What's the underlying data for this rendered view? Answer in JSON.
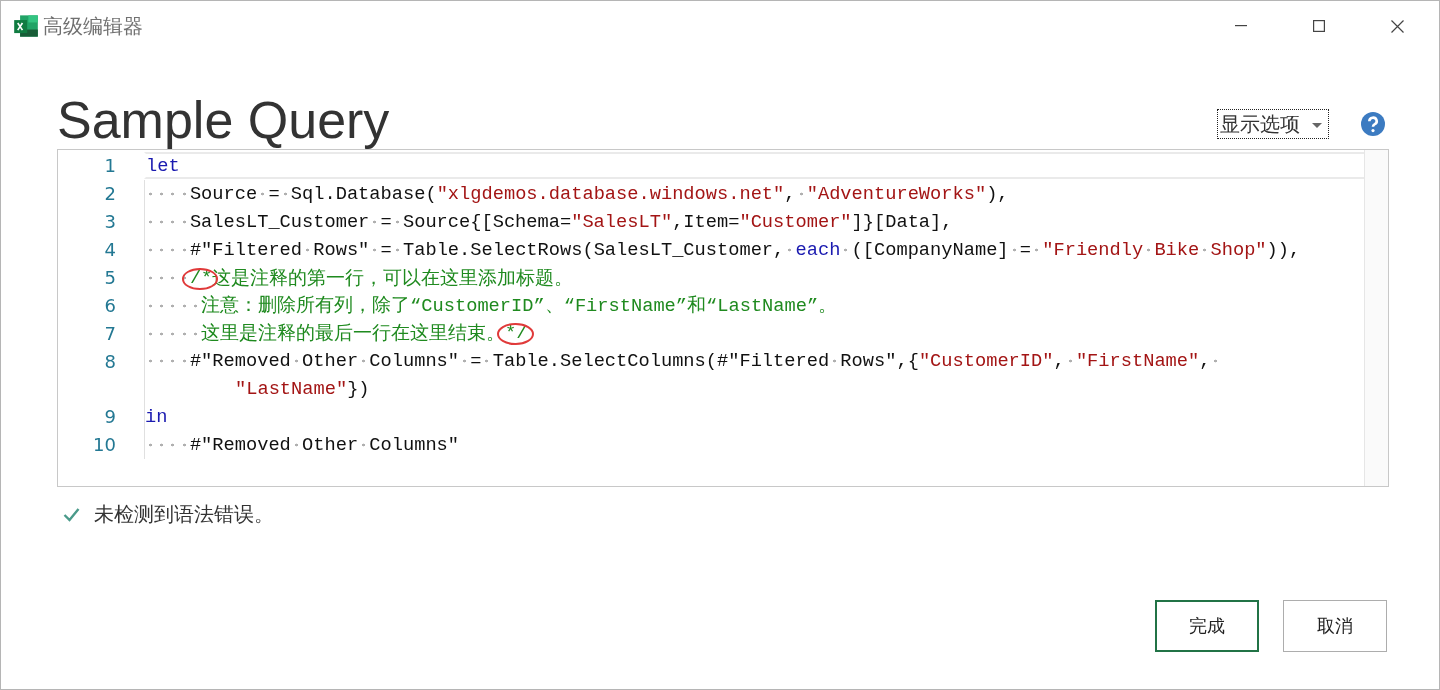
{
  "window": {
    "title": "高级编辑器"
  },
  "heading": "Sample Query",
  "options_dropdown": {
    "label": "显示选项"
  },
  "editor": {
    "lines": [
      {
        "number": "1",
        "current": true,
        "tokens": [
          {
            "kind": "keyword",
            "text": "let"
          }
        ]
      },
      {
        "number": "2",
        "current": false,
        "tokens": [
          {
            "kind": "plain",
            "text": "    Source = Sql.Database("
          },
          {
            "kind": "string",
            "text": "\"xlgdemos.database.windows.net\""
          },
          {
            "kind": "plain",
            "text": ", "
          },
          {
            "kind": "string",
            "text": "\"AdventureWorks\""
          },
          {
            "kind": "plain",
            "text": "),"
          }
        ]
      },
      {
        "number": "3",
        "current": false,
        "tokens": [
          {
            "kind": "plain",
            "text": "    SalesLT_Customer = Source{[Schema="
          },
          {
            "kind": "string",
            "text": "\"SalesLT\""
          },
          {
            "kind": "plain",
            "text": ",Item="
          },
          {
            "kind": "string",
            "text": "\"Customer\""
          },
          {
            "kind": "plain",
            "text": "]}[Data],"
          }
        ]
      },
      {
        "number": "4",
        "current": false,
        "tokens": [
          {
            "kind": "plain",
            "text": "    #\"Filtered Rows\" = Table.SelectRows(SalesLT_Customer, "
          },
          {
            "kind": "keyword",
            "text": "each"
          },
          {
            "kind": "plain",
            "text": " ([CompanyName] = "
          },
          {
            "kind": "string",
            "text": "\"Friendly Bike Shop\""
          },
          {
            "kind": "plain",
            "text": ")),"
          }
        ]
      },
      {
        "number": "5",
        "current": false,
        "tokens": [
          {
            "kind": "comment",
            "text": "    /*",
            "circled": true
          },
          {
            "kind": "comment",
            "text": "这是注释的第一行，可以在这里添加标题。"
          }
        ]
      },
      {
        "number": "6",
        "current": false,
        "tokens": [
          {
            "kind": "comment",
            "text": "     注意：删除所有列，除了“CustomerID”、“FirstName”和“LastName”。"
          }
        ]
      },
      {
        "number": "7",
        "current": false,
        "tokens": [
          {
            "kind": "comment",
            "text": "     这里是注释的最后一行在这里结束。"
          },
          {
            "kind": "comment",
            "text": "*/",
            "circled": true
          }
        ]
      },
      {
        "number": "8",
        "current": false,
        "tokens": [
          {
            "kind": "plain",
            "text": "    #\"Removed Other Columns\" = Table.SelectColumns(#\"Filtered Rows\",{"
          },
          {
            "kind": "string",
            "text": "\"CustomerID\""
          },
          {
            "kind": "plain",
            "text": ", "
          },
          {
            "kind": "string",
            "text": "\"FirstName\""
          },
          {
            "kind": "plain",
            "text": ", "
          }
        ],
        "wrapped": [
          {
            "kind": "string",
            "text": "\"LastName\""
          },
          {
            "kind": "plain",
            "text": "})"
          }
        ]
      },
      {
        "number": "9",
        "current": false,
        "tokens": [
          {
            "kind": "keyword",
            "text": "in"
          }
        ]
      },
      {
        "number": "10",
        "current": false,
        "tokens": [
          {
            "kind": "plain",
            "text": "    #\"Removed Other Columns\""
          }
        ]
      }
    ]
  },
  "status": {
    "kind": "ok",
    "message": "未检测到语法错误。"
  },
  "buttons": [
    {
      "label": "完成",
      "default": true
    },
    {
      "label": "取消",
      "default": false
    }
  ]
}
